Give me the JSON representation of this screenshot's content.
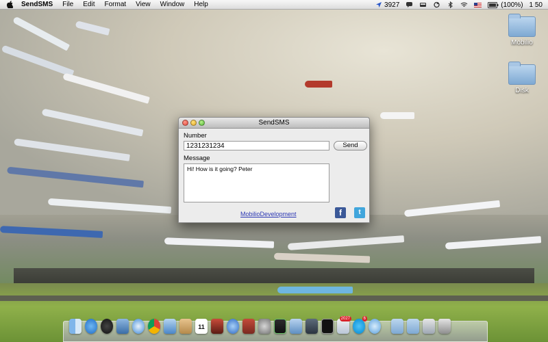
{
  "menubar": {
    "app_name": "SendSMS",
    "items": [
      "File",
      "Edit",
      "Format",
      "View",
      "Window",
      "Help"
    ],
    "status": {
      "location_count": "3927",
      "battery": "(100%)",
      "time": "1 50"
    }
  },
  "desktop": {
    "icons": [
      {
        "label": "Mobilio",
        "icon": "folder-icon"
      },
      {
        "label": "Disk",
        "icon": "folder-icon"
      }
    ]
  },
  "window": {
    "title": "SendSMS",
    "number_label": "Number",
    "number_value": "1231231234",
    "send_label": "Send",
    "message_label": "Message",
    "message_value": "Hi! How is it going? Peter",
    "dev_link": "MobilioDevelopment",
    "facebook_glyph": "f",
    "twitter_glyph": "t"
  },
  "dock": {
    "calendar_day": "11",
    "badge_mail": "2027",
    "badge_skype": "6"
  },
  "colors": {
    "link": "#2a36b3",
    "facebook": "#3b5998",
    "twitter": "#41a6dc"
  }
}
